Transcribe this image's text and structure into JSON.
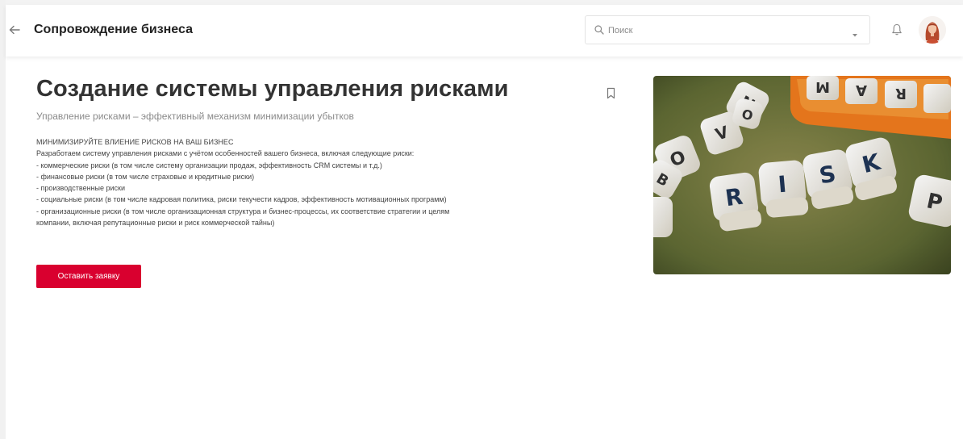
{
  "header": {
    "title": "Сопровождение бизнеса",
    "search_placeholder": "Поиск",
    "back_icon": "arrow-left-icon",
    "search_icon": "search-icon",
    "caret_icon": "caret-down-icon",
    "notification_icon": "bell-icon"
  },
  "page": {
    "title": "Создание системы управления рисками",
    "subtitle": "Управление рисками – эффективный механизм минимизации убытков",
    "description": [
      "МИНИМИЗИРУЙТЕ ВЛИЕНИЕ РИСКОВ НА ВАШ БИЗНЕС",
      "Разработаем систему управления рисками с учётом особенностей вашего бизнеса, включая следующие риски:",
      "- коммерческие риски (в том числе систему организации продаж, эффективность CRM системы и т.д.)",
      "- финансовые риски (в том числе страховые и кредитные риски)",
      "- производственные риски",
      "- социальные риски (в том числе кадровая политика, риски текучести кадров, эффективность мотивационных программ)",
      "- организационные риски (в том числе организационная структура и бизнес-процессы, их соответствие стратегии и целям",
      "компании, включая репутационные риски и риск коммерческой тайны)"
    ],
    "cta_label": "Оставить заявку",
    "bookmark_icon": "bookmark-icon"
  },
  "colors": {
    "accent": "#d9002f",
    "title": "#333333",
    "subtitle": "#8b8b8b"
  }
}
